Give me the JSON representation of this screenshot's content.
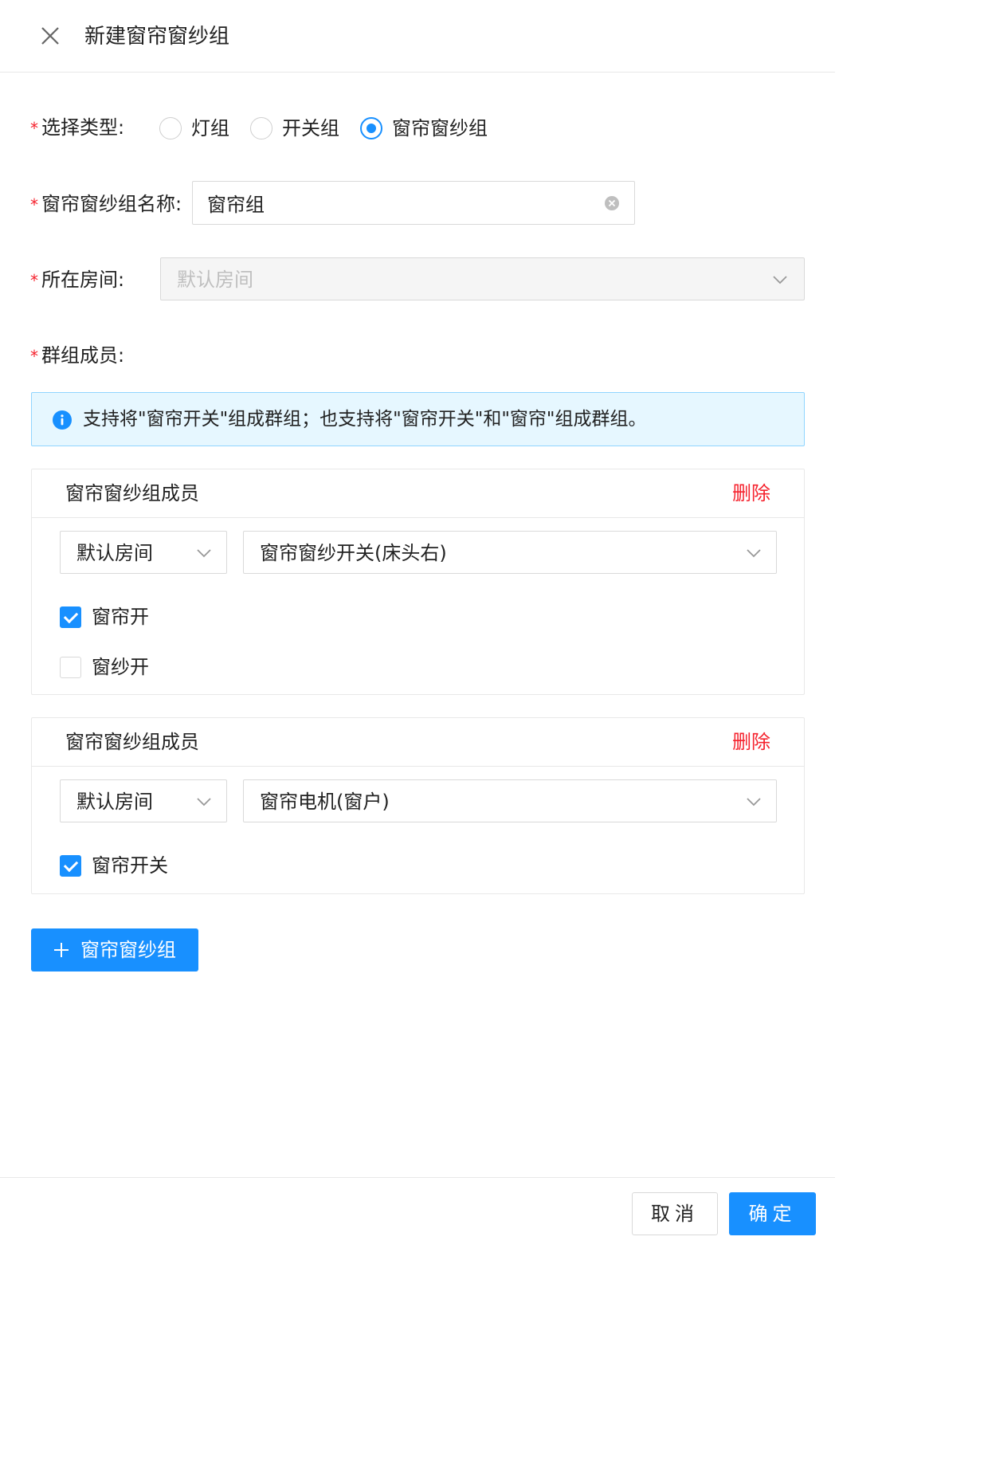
{
  "dialog": {
    "title": "新建窗帘窗纱组",
    "close_icon": "close-icon"
  },
  "form": {
    "required_mark": "*",
    "type": {
      "label": "选择类型:",
      "options": [
        {
          "label": "灯组",
          "selected": false
        },
        {
          "label": "开关组",
          "selected": false
        },
        {
          "label": "窗帘窗纱组",
          "selected": true
        }
      ]
    },
    "name": {
      "label": "窗帘窗纱组名称:",
      "value": "窗帘组",
      "clear_icon": "clear-circle-icon"
    },
    "room": {
      "label": "所在房间:",
      "value": "默认房间",
      "disabled": true
    },
    "members": {
      "label": "群组成员:"
    }
  },
  "alert": {
    "icon": "info-circle-icon",
    "text": "支持将\"窗帘开关\"组成群组；也支持将\"窗帘开关\"和\"窗帘\"组成群组。"
  },
  "member_cards": [
    {
      "title": "窗帘窗纱组成员",
      "delete_label": "删除",
      "room": "默认房间",
      "device": "窗帘窗纱开关(床头右)",
      "options": [
        {
          "label": "窗帘开",
          "checked": true
        },
        {
          "label": "窗纱开",
          "checked": false
        }
      ]
    },
    {
      "title": "窗帘窗纱组成员",
      "delete_label": "删除",
      "room": "默认房间",
      "device": "窗帘电机(窗户)",
      "options": [
        {
          "label": "窗帘开关",
          "checked": true
        }
      ]
    }
  ],
  "add_button": {
    "icon": "plus-icon",
    "label": "窗帘窗纱组"
  },
  "footer": {
    "cancel_label": "取消",
    "ok_label": "确定"
  },
  "colors": {
    "primary": "#1890ff",
    "danger": "#f5222d",
    "alert_bg": "#e6f7ff",
    "alert_border": "#91d5ff"
  }
}
